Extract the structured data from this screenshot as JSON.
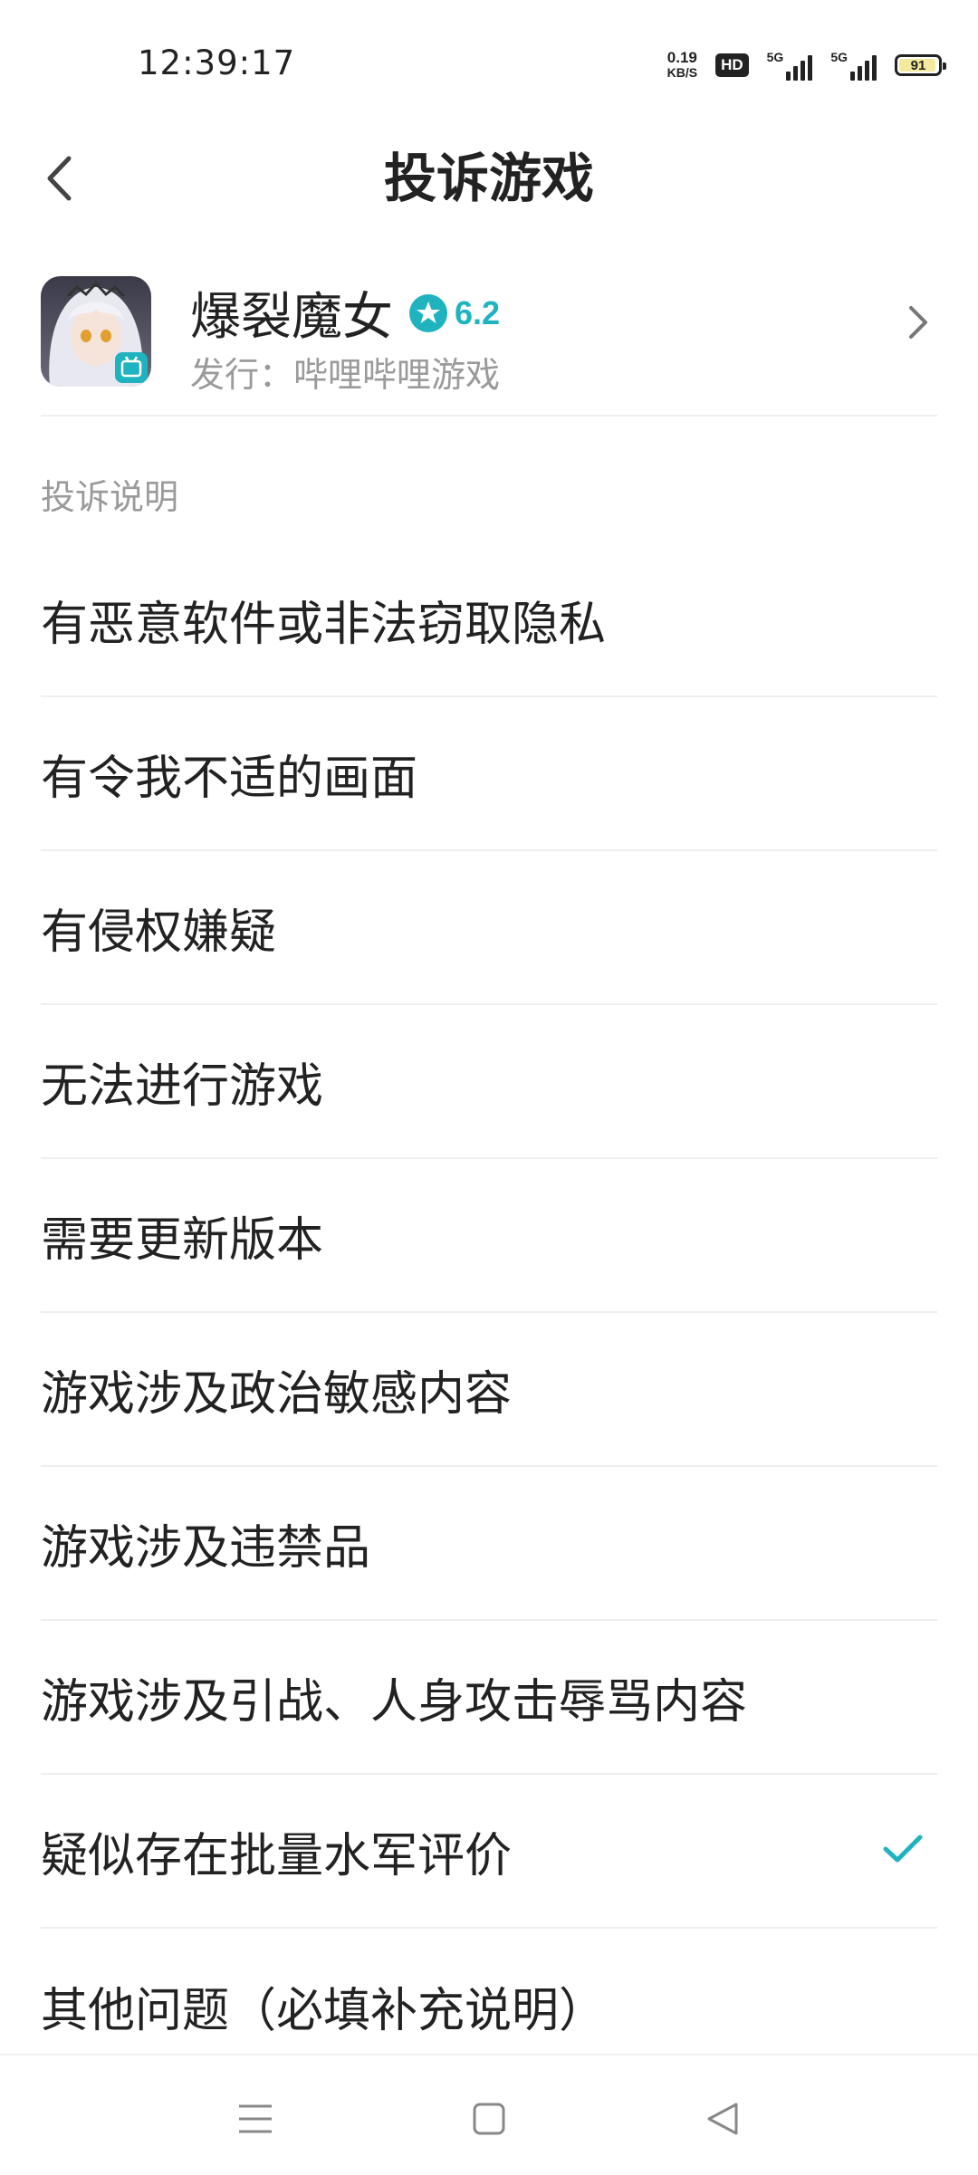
{
  "status_bar": {
    "time": "12:39:17",
    "net_speed_value": "0.19",
    "net_speed_unit": "KB/S",
    "hd_label": "HD",
    "signal1_label": "5G",
    "signal2_label": "5G",
    "battery": "91"
  },
  "header": {
    "title": "投诉游戏",
    "back_icon": "chevron-left-icon"
  },
  "game": {
    "name": "爆裂魔女",
    "rating": "6.2",
    "publisher": "发行：哔哩哔哩游戏",
    "rating_color": "#1fb3bf"
  },
  "section": {
    "label": "投诉说明"
  },
  "options": [
    {
      "label": "有恶意软件或非法窃取隐私",
      "selected": false
    },
    {
      "label": "有令我不适的画面",
      "selected": false
    },
    {
      "label": "有侵权嫌疑",
      "selected": false
    },
    {
      "label": "无法进行游戏",
      "selected": false
    },
    {
      "label": "需要更新版本",
      "selected": false
    },
    {
      "label": "游戏涉及政治敏感内容",
      "selected": false
    },
    {
      "label": "游戏涉及违禁品",
      "selected": false
    },
    {
      "label": "游戏涉及引战、人身攻击辱骂内容",
      "selected": false
    },
    {
      "label": "疑似存在批量水军评价",
      "selected": true
    },
    {
      "label": "其他问题（必填补充说明）",
      "selected": false
    }
  ],
  "colors": {
    "accent": "#1fb3bf",
    "text": "#222222",
    "secondary": "#9a9a9a",
    "divider": "#eeeeee"
  },
  "navbar": {
    "icons": [
      "menu-icon",
      "home-square-icon",
      "back-triangle-icon"
    ]
  }
}
